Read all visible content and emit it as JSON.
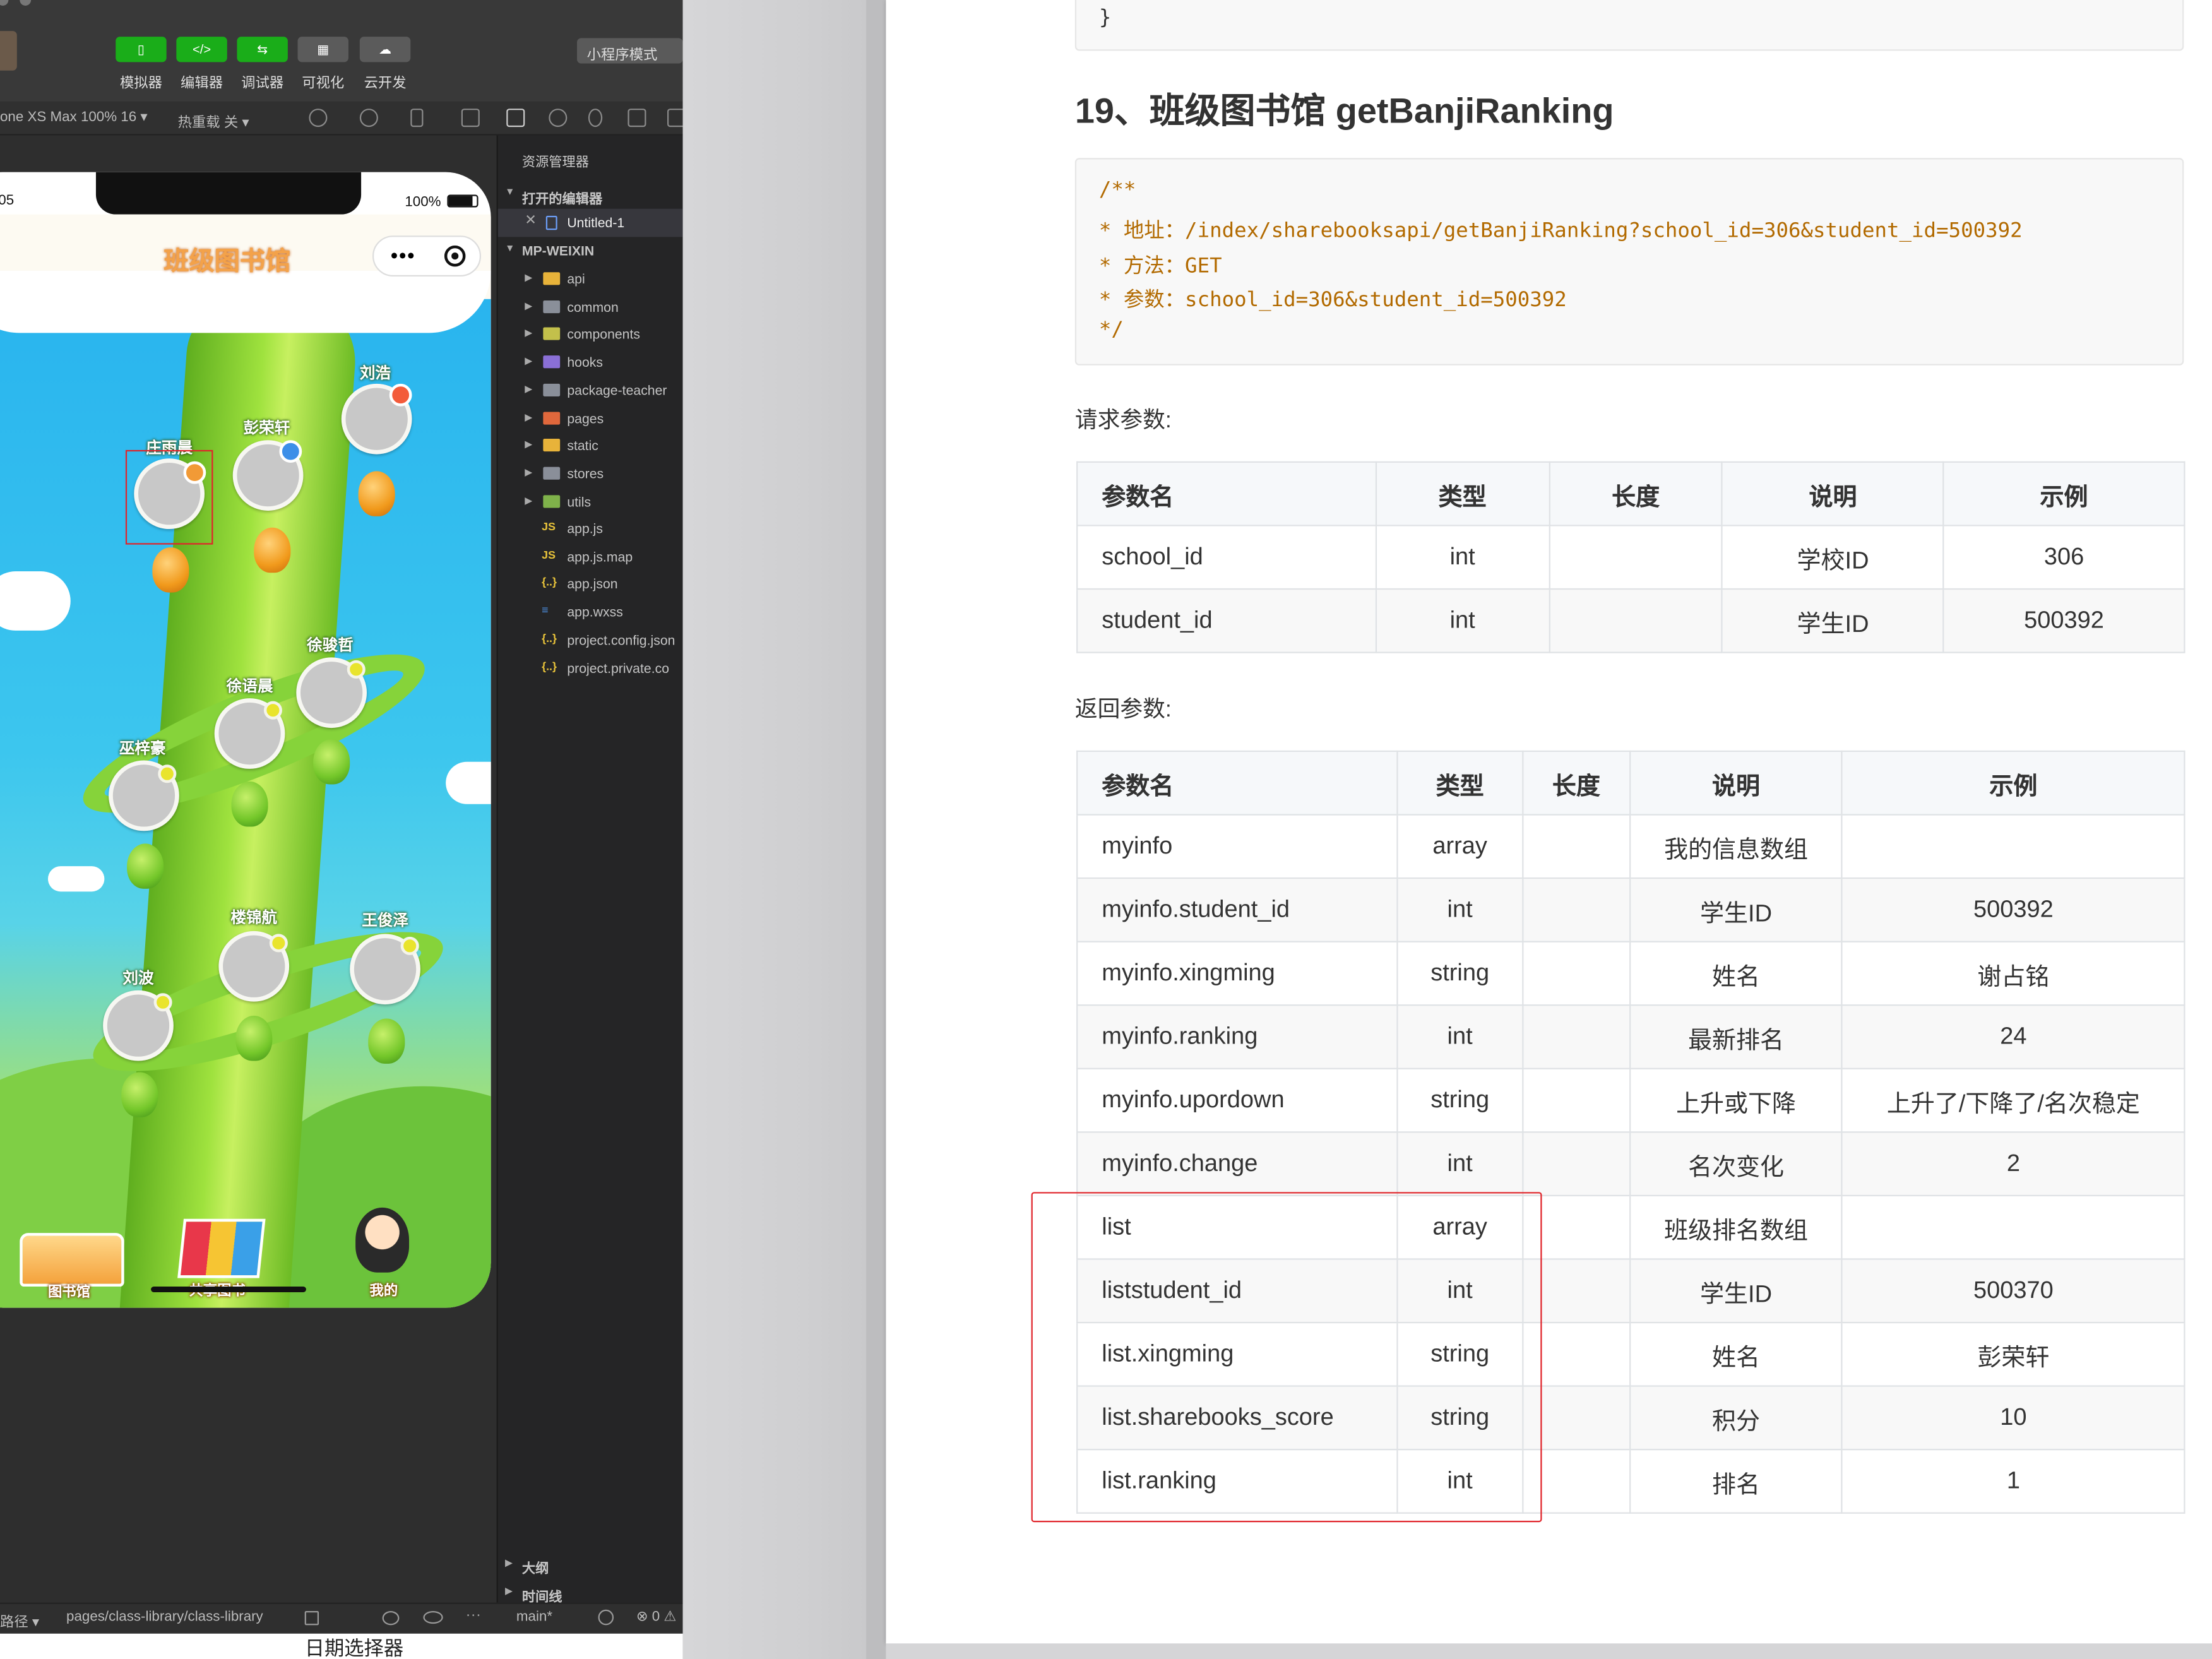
{
  "toolbar": {
    "buttons": [
      {
        "label": "模拟器",
        "icon": "phone-icon"
      },
      {
        "label": "编辑器",
        "icon": "code-icon"
      },
      {
        "label": "调试器",
        "icon": "debug-icon"
      },
      {
        "label": "可视化",
        "icon": "layout-icon"
      },
      {
        "label": "云开发",
        "icon": "cloud-icon"
      }
    ],
    "mode": "小程序模式"
  },
  "subbar": {
    "device": "one XS Max 100% 16 ▾",
    "hot_reload": "热重载 关 ▾"
  },
  "phone": {
    "time": ":05",
    "battery": "100%",
    "title": "班级图书馆",
    "nodes": [
      {
        "name": "刘浩"
      },
      {
        "name": "彭荣轩"
      },
      {
        "name": "庄雨晨"
      },
      {
        "name": "徐骏哲"
      },
      {
        "name": "徐语晨"
      },
      {
        "name": "巫梓豪"
      },
      {
        "name": "楼锦航"
      },
      {
        "name": "王俊泽"
      },
      {
        "name": "刘波"
      }
    ],
    "tabs": [
      {
        "label": "图书馆"
      },
      {
        "label": "共享图书"
      },
      {
        "label": "我的"
      }
    ]
  },
  "explorer": {
    "title": "资源管理器",
    "open_editors": "打开的编辑器",
    "open_file": "Untitled-1",
    "root": "MP-WEIXIN",
    "folders": [
      {
        "name": "api",
        "color": "#e8b33a"
      },
      {
        "name": "common",
        "color": "#8a8f99"
      },
      {
        "name": "components",
        "color": "#c3c04b"
      },
      {
        "name": "hooks",
        "color": "#8a6fd6"
      },
      {
        "name": "package-teacher",
        "color": "#8a8f99"
      },
      {
        "name": "pages",
        "color": "#e0683c"
      },
      {
        "name": "static",
        "color": "#e8b33a"
      },
      {
        "name": "stores",
        "color": "#8a8f99"
      },
      {
        "name": "utils",
        "color": "#7fb24a"
      }
    ],
    "files": [
      {
        "name": "app.js",
        "icon": "JS",
        "color": "#e8c33a"
      },
      {
        "name": "app.js.map",
        "icon": "JS",
        "color": "#e8c33a"
      },
      {
        "name": "app.json",
        "icon": "{..}",
        "color": "#e8c33a"
      },
      {
        "name": "app.wxss",
        "icon": "≡",
        "color": "#4d8fe0"
      },
      {
        "name": "project.config.json",
        "icon": "{..}",
        "color": "#e8c33a"
      },
      {
        "name": "project.private.co",
        "icon": "{..}",
        "color": "#e8c33a"
      }
    ],
    "outline": "大纲",
    "timeline": "时间线"
  },
  "status": {
    "path_label": "路径 ▾",
    "page_path": "pages/class-library/class-library",
    "branch": "main*",
    "errors": "⊗ 0 ⚠"
  },
  "bottom_peek": "日期选择器",
  "doc": {
    "top_brace": "}",
    "heading": "19、班级图书馆 getBanjiRanking",
    "code_lines": [
      "/**",
      "* 地址：/index/sharebooksapi/getBanjiRanking?school_id=306&student_id=500392",
      "* 方法：GET",
      "* 参数：school_id=306&student_id=500392",
      "*/"
    ],
    "request_label": "请求参数:",
    "request_headers": [
      "参数名",
      "类型",
      "长度",
      "说明",
      "示例"
    ],
    "request_rows": [
      [
        "school_id",
        "int",
        "",
        "学校ID",
        "306"
      ],
      [
        "student_id",
        "int",
        "",
        "学生ID",
        "500392"
      ]
    ],
    "response_label": "返回参数:",
    "response_headers": [
      "参数名",
      "类型",
      "长度",
      "说明",
      "示例"
    ],
    "response_rows": [
      [
        "myinfo",
        "array",
        "",
        "我的信息数组",
        ""
      ],
      [
        "myinfo.student_id",
        "int",
        "",
        "学生ID",
        "500392"
      ],
      [
        "myinfo.xingming",
        "string",
        "",
        "姓名",
        "谢占铭"
      ],
      [
        "myinfo.ranking",
        "int",
        "",
        "最新排名",
        "24"
      ],
      [
        "myinfo.upordown",
        "string",
        "",
        "上升或下降",
        "上升了/下降了/名次稳定"
      ],
      [
        "myinfo.change",
        "int",
        "",
        "名次变化",
        "2"
      ],
      [
        "list",
        "array",
        "",
        "班级排名数组",
        ""
      ],
      [
        "liststudent_id",
        "int",
        "",
        "学生ID",
        "500370"
      ],
      [
        "list.xingming",
        "string",
        "",
        "姓名",
        "彭荣轩"
      ],
      [
        "list.sharebooks_score",
        "string",
        "",
        "积分",
        "10"
      ],
      [
        "list.ranking",
        "int",
        "",
        "排名",
        "1"
      ]
    ]
  }
}
